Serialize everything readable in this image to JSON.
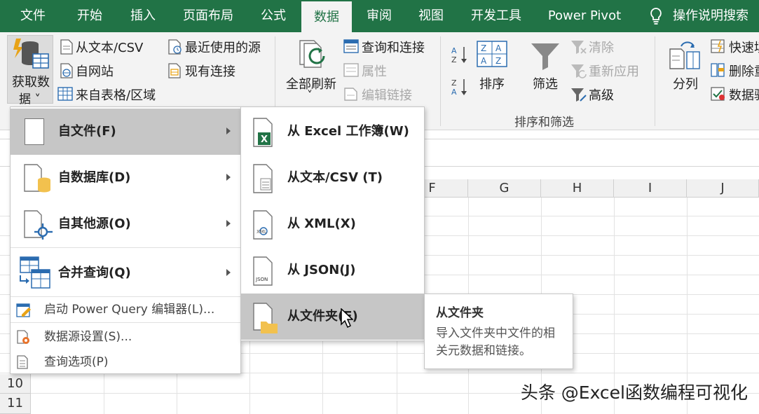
{
  "ribbon_tabs": [
    {
      "label": "文件"
    },
    {
      "label": "开始"
    },
    {
      "label": "插入"
    },
    {
      "label": "页面布局"
    },
    {
      "label": "公式"
    },
    {
      "label": "数据",
      "active": true
    },
    {
      "label": "审阅"
    },
    {
      "label": "视图"
    },
    {
      "label": "开发工具"
    },
    {
      "label": "Power Pivot"
    },
    {
      "label": "操作说明搜索",
      "icon": "lightbulb-icon"
    }
  ],
  "ribbon": {
    "get_data": {
      "line1": "获取数",
      "line2": "据 ˅"
    },
    "from_text_csv": "从文本/CSV",
    "from_web": "自网站",
    "from_table": "来自表格/区域",
    "recent_sources": "最近使用的源",
    "existing_connections": "现有连接",
    "refresh_all": {
      "line1": "全部刷新",
      "line2": "˅"
    },
    "queries_connections": "查询和连接",
    "properties": "属性",
    "edit_links": "编辑链接",
    "sort": "排序",
    "filter": "筛选",
    "clear": "清除",
    "reapply": "重新应用",
    "advanced": "高级",
    "sort_filter_group": "排序和筛选",
    "text_to_columns": "分列",
    "flash_fill": "快速填",
    "remove_duplicates": "删除重",
    "data_validation": "数据验"
  },
  "grid": {
    "columns": [
      "F",
      "G",
      "H",
      "I",
      "J"
    ],
    "rows": [
      "10",
      "11"
    ]
  },
  "menu_main": {
    "items": [
      {
        "label": "自文件(F)",
        "icon": "file-icon",
        "highlighted": true,
        "submenu": true
      },
      {
        "label": "自数据库(D)",
        "icon": "database-icon",
        "submenu": true
      },
      {
        "label": "自其他源(O)",
        "icon": "other-source-icon",
        "submenu": true
      },
      {
        "label": "合并查询(Q)",
        "icon": "combine-query-icon",
        "submenu": true
      }
    ],
    "small_items": [
      {
        "label": "启动 Power Query 编辑器(L)...",
        "icon": "power-query-editor-icon"
      },
      {
        "label": "数据源设置(S)...",
        "icon": "data-source-settings-icon"
      },
      {
        "label": "查询选项(P)",
        "icon": "query-options-icon"
      }
    ]
  },
  "menu_file": {
    "items": [
      {
        "label": "从 Excel 工作簿(W)",
        "icon": "excel-workbook-icon"
      },
      {
        "label": "从文本/CSV (T)",
        "icon": "text-file-icon"
      },
      {
        "label": "从 XML(X)",
        "icon": "xml-file-icon",
        "badge": "XML"
      },
      {
        "label": "从 JSON(J)",
        "icon": "json-file-icon",
        "badge": "JSON"
      },
      {
        "label": "从文件夹(F)",
        "icon": "folder-icon",
        "highlighted": true
      }
    ]
  },
  "tooltip": {
    "title": "从文件夹",
    "body": "导入文件夹中文件的相关元数据和链接。"
  },
  "watermark": "头条 @Excel函数编程可视化",
  "colors": {
    "accent": "#217346",
    "ribbon_bg": "#f3f3f3",
    "menu_highlight": "#c6c6c6"
  }
}
